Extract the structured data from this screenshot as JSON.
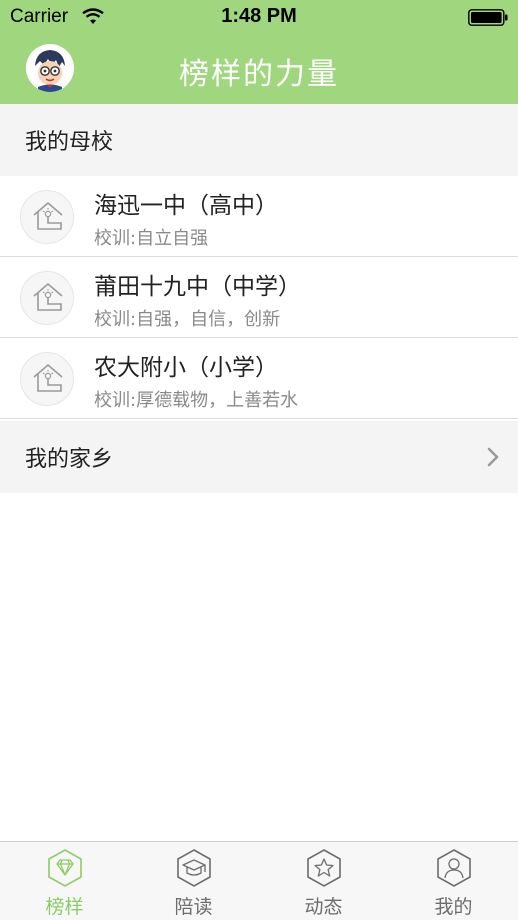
{
  "status_bar": {
    "carrier": "Carrier",
    "time": "1:48 PM"
  },
  "nav": {
    "title": "榜样的力量",
    "background_color": "#9fd67e"
  },
  "sections": {
    "alma_mater": {
      "title": "我的母校"
    },
    "hometown": {
      "title": "我的家乡"
    }
  },
  "schools": [
    {
      "name": "海迅一中（高中）",
      "motto": "校训:自立自强",
      "icon": "school-house-icon"
    },
    {
      "name": "莆田十九中（中学）",
      "motto": "校训:自强，自信，创新",
      "icon": "school-house-icon"
    },
    {
      "name": "农大附小（小学）",
      "motto": "校训:厚德载物，上善若水",
      "icon": "school-house-icon"
    }
  ],
  "tabs": [
    {
      "label": "榜样",
      "icon": "diamond-icon",
      "active": true
    },
    {
      "label": "陪读",
      "icon": "graduation-cap-icon",
      "active": false
    },
    {
      "label": "动态",
      "icon": "star-icon",
      "active": false
    },
    {
      "label": "我的",
      "icon": "user-icon",
      "active": false
    }
  ],
  "colors": {
    "accent": "#8ccc68",
    "inactive_tab": "#6d6d6d"
  }
}
